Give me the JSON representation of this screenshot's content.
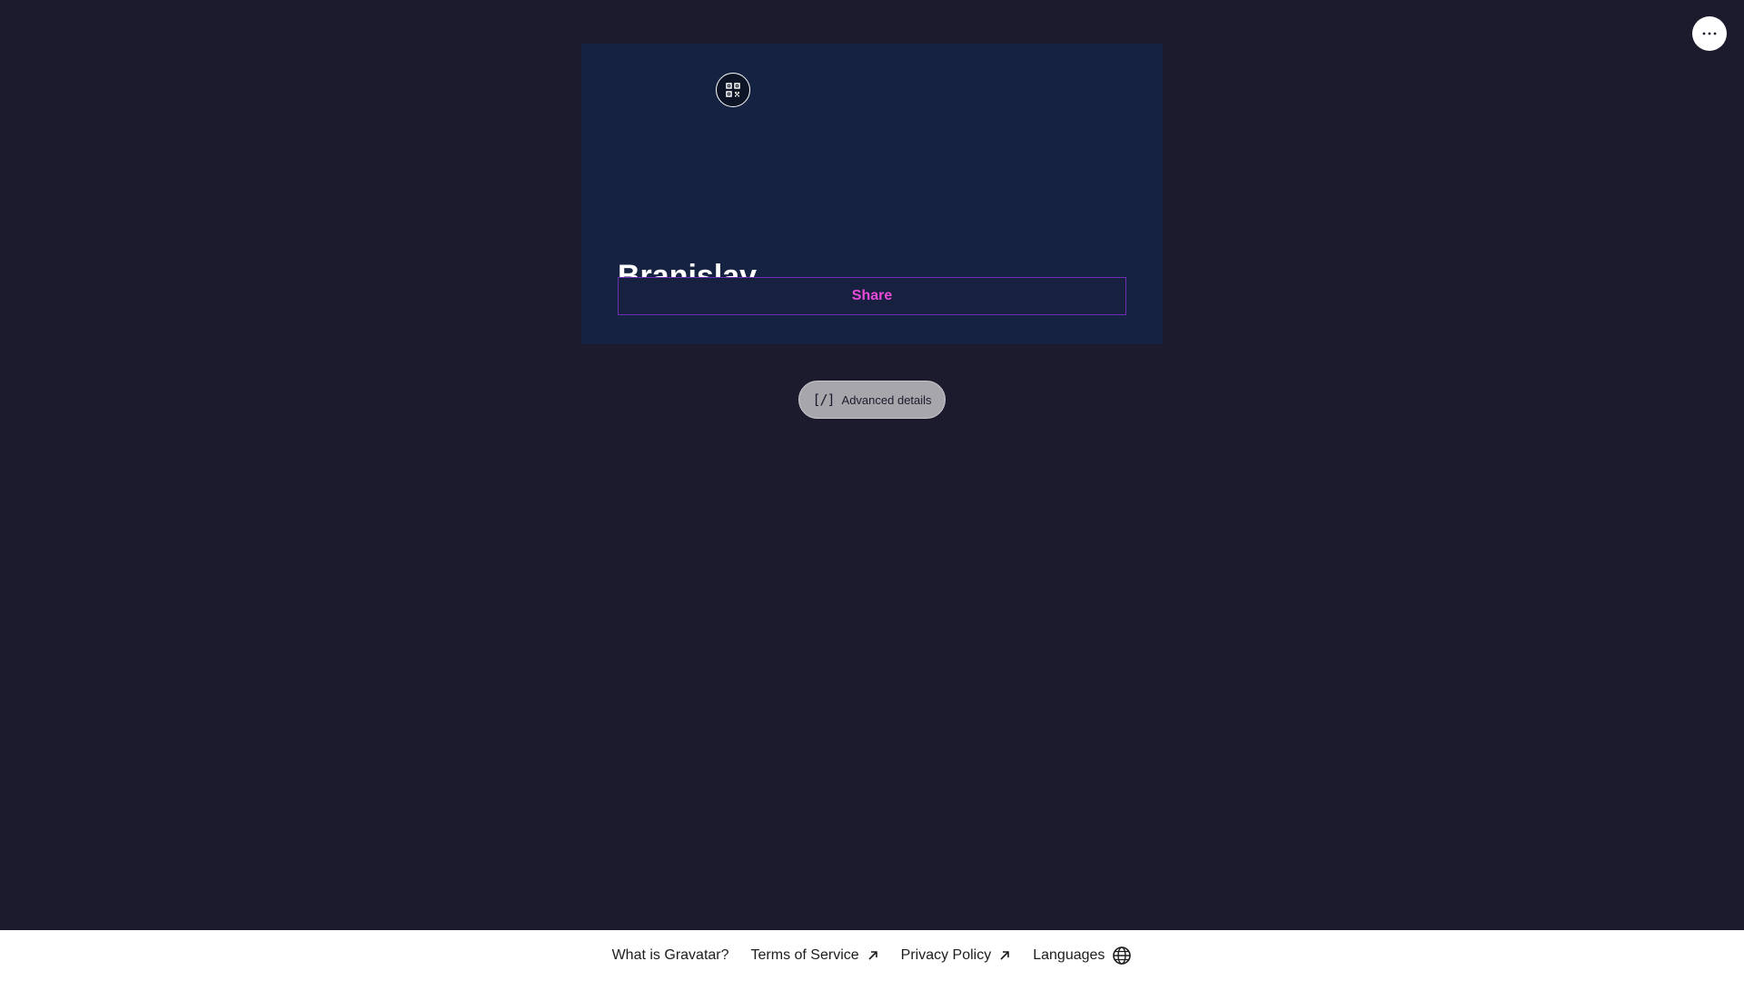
{
  "header": {
    "more_icon": "more-horizontal-icon"
  },
  "profile": {
    "qr_icon": "qr-code-icon",
    "name": "Branislav",
    "share_label": "Share"
  },
  "advanced": {
    "icon": "code-brackets-icon",
    "icon_text": "[/]",
    "label": "Advanced details"
  },
  "footer": {
    "links": [
      {
        "label": "What is Gravatar?",
        "icon": ""
      },
      {
        "label": "Terms of Service",
        "icon": "external-link-arrow-icon"
      },
      {
        "label": "Privacy Policy",
        "icon": "external-link-arrow-icon"
      },
      {
        "label": "Languages",
        "icon": "globe-icon"
      }
    ]
  },
  "colors": {
    "background": "#1c1b2e",
    "card": "#162242",
    "accent": "#e94bd8",
    "share_border": "#6a2fb0",
    "footer_background": "#ffffff"
  }
}
